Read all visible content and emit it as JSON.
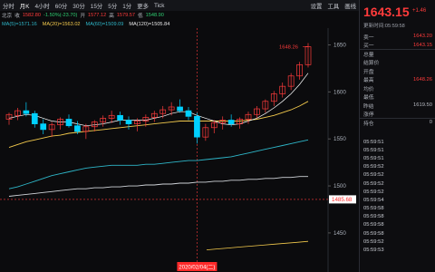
{
  "toolbar": {
    "items": [
      "分时",
      "月K",
      "4小时",
      "60分",
      "30分",
      "15分",
      "5分",
      "1分",
      "更多",
      "Tick"
    ],
    "active_index": 1,
    "right_items": [
      "设置",
      "工具",
      "画线"
    ]
  },
  "info_bar": {
    "exchange": "北京",
    "collect": "收",
    "close_value": "1582.80",
    "change": "-1.50%(-23.70)",
    "open_label": "开",
    "open_value": "1577.12",
    "high_label": "高",
    "high_value": "1579.57",
    "low_label": "低",
    "low_value": "1548.90"
  },
  "ma_bar": {
    "ma5": "MA(5)=1571.16",
    "ma20": "MA(20)=1563.02",
    "ma60": "MA(60)=1509.09",
    "ma120": "MA(120)=1505.84"
  },
  "chart_data": {
    "type": "candlestick",
    "ylim": [
      1420,
      1665
    ],
    "y_ticks": [
      1650,
      1600,
      1550,
      1500,
      1450
    ],
    "price_flag_top": "1648.26",
    "price_flag_right": "1485.68",
    "cursor_date": "2020/02/04(二)",
    "candles": [
      [
        1571,
        1578,
        1565,
        1576
      ],
      [
        1575,
        1583,
        1570,
        1580
      ],
      [
        1580,
        1589,
        1574,
        1577
      ],
      [
        1577,
        1580,
        1562,
        1566
      ],
      [
        1566,
        1571,
        1555,
        1560
      ],
      [
        1560,
        1568,
        1552,
        1565
      ],
      [
        1565,
        1573,
        1560,
        1571
      ],
      [
        1571,
        1576,
        1562,
        1564
      ],
      [
        1564,
        1569,
        1555,
        1558
      ],
      [
        1558,
        1566,
        1550,
        1563
      ],
      [
        1563,
        1570,
        1558,
        1568
      ],
      [
        1568,
        1575,
        1563,
        1572
      ],
      [
        1572,
        1580,
        1567,
        1575
      ],
      [
        1575,
        1579,
        1565,
        1570
      ],
      [
        1570,
        1574,
        1560,
        1566
      ],
      [
        1566,
        1572,
        1558,
        1569
      ],
      [
        1569,
        1576,
        1563,
        1573
      ],
      [
        1573,
        1580,
        1568,
        1577
      ],
      [
        1577,
        1585,
        1572,
        1581
      ],
      [
        1581,
        1589,
        1575,
        1584
      ],
      [
        1584,
        1592,
        1578,
        1580
      ],
      [
        1580,
        1584,
        1570,
        1574
      ],
      [
        1574,
        1578,
        1545,
        1552
      ],
      [
        1552,
        1566,
        1548,
        1562
      ],
      [
        1562,
        1570,
        1556,
        1567
      ],
      [
        1567,
        1574,
        1560,
        1570
      ],
      [
        1570,
        1576,
        1563,
        1566
      ],
      [
        1566,
        1573,
        1561,
        1571
      ],
      [
        1571,
        1579,
        1566,
        1576
      ],
      [
        1576,
        1585,
        1572,
        1582
      ],
      [
        1582,
        1592,
        1578,
        1590
      ],
      [
        1590,
        1601,
        1585,
        1598
      ],
      [
        1598,
        1610,
        1594,
        1606
      ],
      [
        1606,
        1620,
        1602,
        1617
      ],
      [
        1617,
        1632,
        1613,
        1629
      ],
      [
        1629,
        1652,
        1626,
        1648
      ]
    ],
    "ma_lines": {
      "ma5": [
        1572,
        1574,
        1576,
        1575,
        1572,
        1569,
        1568,
        1568,
        1566,
        1564,
        1565,
        1566,
        1568,
        1570,
        1570,
        1570,
        1570,
        1572,
        1574,
        1577,
        1579,
        1579,
        1575,
        1572,
        1569,
        1566,
        1565,
        1566,
        1569,
        1572,
        1577,
        1583,
        1590,
        1598,
        1608,
        1620
      ],
      "ma20": [
        1541,
        1544,
        1547,
        1549,
        1551,
        1553,
        1554,
        1556,
        1557,
        1558,
        1559,
        1560,
        1561,
        1562,
        1563,
        1564,
        1565,
        1566,
        1567,
        1568,
        1569,
        1569,
        1569,
        1569,
        1569,
        1569,
        1569,
        1569,
        1570,
        1571,
        1573,
        1575,
        1578,
        1581,
        1585,
        1590
      ],
      "ma60": [
        1497,
        1499,
        1502,
        1505,
        1508,
        1511,
        1513,
        1515,
        1517,
        1519,
        1520,
        1521,
        1522,
        1522,
        1522,
        1522,
        1523,
        1523,
        1524,
        1525,
        1526,
        1527,
        1527,
        1528,
        1529,
        1530,
        1531,
        1533,
        1535,
        1537,
        1539,
        1541,
        1543,
        1545,
        1547,
        1549
      ],
      "ma120": [
        1489,
        1490,
        1491,
        1492,
        1493,
        1494,
        1495,
        1496,
        1497,
        1497,
        1498,
        1498,
        1499,
        1499,
        1500,
        1500,
        1501,
        1501,
        1502,
        1502,
        1503,
        1503,
        1504,
        1504,
        1505,
        1505,
        1506,
        1506,
        1507,
        1507,
        1508,
        1508,
        1509,
        1509,
        1510,
        1510
      ]
    },
    "lower_line": [
      1432,
      1433,
      1434,
      1435,
      1436,
      1437,
      1438,
      1439,
      1440,
      1441
    ]
  },
  "side_panel": {
    "price": "1643.15",
    "change": "+1.46",
    "update_time": "更新时间:05:59:58",
    "rows": [
      {
        "label": "卖一",
        "value": "1643.20",
        "cls": "red"
      },
      {
        "label": "买一",
        "value": "1643.15",
        "cls": "red"
      },
      {
        "label": "总量",
        "value": "",
        "cls": ""
      },
      {
        "label": "结算价",
        "value": "",
        "cls": ""
      },
      {
        "label": "开盘",
        "value": "",
        "cls": ""
      },
      {
        "label": "最高",
        "value": "1648.26",
        "cls": "red"
      },
      {
        "label": "均价",
        "value": "",
        "cls": ""
      },
      {
        "label": "最低",
        "value": "",
        "cls": ""
      },
      {
        "label": "昨结",
        "value": "1619.50",
        "cls": ""
      },
      {
        "label": "涨停",
        "value": "",
        "cls": ""
      },
      {
        "label": "持仓",
        "value": "0",
        "cls": ""
      }
    ],
    "ticks": [
      "05:59:51",
      "05:59:51",
      "05:59:51",
      "05:59:52",
      "05:59:52",
      "05:59:52",
      "05:59:52",
      "05:59:54",
      "05:59:58",
      "05:59:58",
      "05:59:58",
      "05:59:58",
      "05:59:52",
      "05:59:53"
    ]
  },
  "colors": {
    "up": "#ff3b3b",
    "down": "#00d0ff",
    "ma5": "#ffffff",
    "ma20": "#f2c94c",
    "ma60": "#2eb6c8",
    "ma120": "#cfd3d8"
  }
}
